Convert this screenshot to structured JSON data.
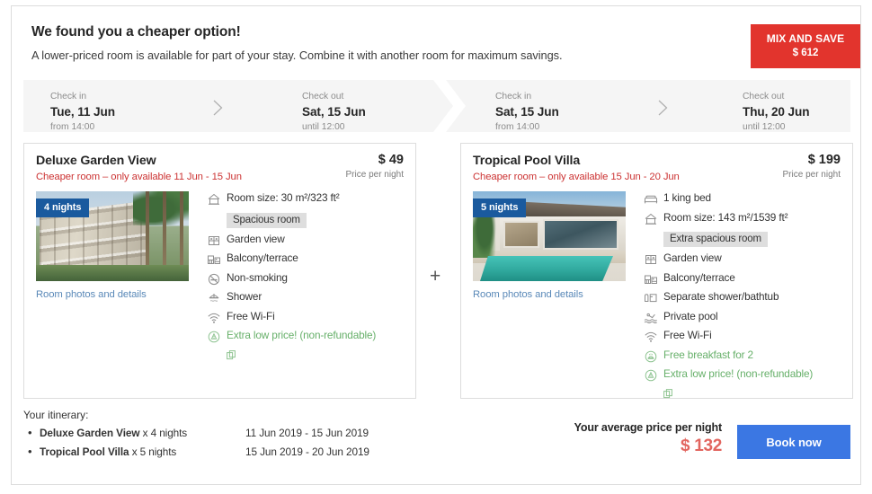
{
  "header": {
    "headline": "We found you a cheaper option!",
    "subline": "A lower-priced room is available for part of your stay. Combine it with another room for maximum savings.",
    "badge": {
      "title": "MIX AND SAVE",
      "amount": "$ 612",
      "color": "#e2342d"
    }
  },
  "timeline": [
    {
      "checkin_label": "Check in",
      "checkin_date": "Tue, 11 Jun",
      "checkin_time": "from 14:00",
      "checkout_label": "Check out",
      "checkout_date": "Sat, 15 Jun",
      "checkout_time": "until 12:00"
    },
    {
      "checkin_label": "Check in",
      "checkin_date": "Sat, 15 Jun",
      "checkin_time": "from 14:00",
      "checkout_label": "Check out",
      "checkout_date": "Thu, 20 Jun",
      "checkout_time": "until 12:00"
    }
  ],
  "separator": "+",
  "rooms": [
    {
      "name": "Deluxe Garden View",
      "note": "Cheaper room – only available 11 Jun - 15 Jun",
      "price": "$ 49",
      "price_label": "Price per night",
      "nights_badge": "4 nights",
      "photo_link": "Room photos and details",
      "amenities": [
        {
          "icon": "room-size-icon",
          "text": "Room size: 30 m²/323 ft²",
          "green": false
        },
        {
          "icon": "window-icon",
          "text": "Garden view",
          "green": false
        },
        {
          "icon": "balcony-icon",
          "text": "Balcony/terrace",
          "green": false
        },
        {
          "icon": "non-smoking-icon",
          "text": "Non-smoking",
          "green": false
        },
        {
          "icon": "shower-icon",
          "text": "Shower",
          "green": false
        },
        {
          "icon": "wifi-icon",
          "text": "Free Wi-Fi",
          "green": false
        },
        {
          "icon": "info-circle-icon",
          "text": "Extra low price! (non-refundable)",
          "green": true
        }
      ],
      "tag": "Spacious room",
      "tag_after_index": 0
    },
    {
      "name": "Tropical Pool Villa",
      "note": "Cheaper room – only available 15 Jun - 20 Jun",
      "price": "$ 199",
      "price_label": "Price per night",
      "nights_badge": "5 nights",
      "photo_link": "Room photos and details",
      "amenities": [
        {
          "icon": "bed-icon",
          "text": "1 king bed",
          "green": false
        },
        {
          "icon": "room-size-icon",
          "text": "Room size: 143 m²/1539 ft²",
          "green": false
        },
        {
          "icon": "window-icon",
          "text": "Garden view",
          "green": false
        },
        {
          "icon": "balcony-icon",
          "text": "Balcony/terrace",
          "green": false
        },
        {
          "icon": "bathtub-icon",
          "text": "Separate shower/bathtub",
          "green": false
        },
        {
          "icon": "pool-icon",
          "text": "Private pool",
          "green": false
        },
        {
          "icon": "wifi-icon",
          "text": "Free Wi-Fi",
          "green": false
        },
        {
          "icon": "breakfast-icon",
          "text": "Free breakfast for 2",
          "green": true
        },
        {
          "icon": "info-circle-icon",
          "text": "Extra low price! (non-refundable)",
          "green": true
        }
      ],
      "tag": "Extra spacious room",
      "tag_after_index": 1
    }
  ],
  "footer": {
    "itinerary_title": "Your itinerary:",
    "itinerary": [
      {
        "name": "Deluxe Garden View",
        "nights": "x 4 nights",
        "dates": "11 Jun 2019 - 15 Jun 2019"
      },
      {
        "name": "Tropical Pool Villa",
        "nights": "x 5 nights",
        "dates": "15 Jun 2019 - 20 Jun 2019"
      }
    ],
    "average_label": "Your average price per night",
    "average_price": "$ 132",
    "book_button": "Book now",
    "book_color": "#3b77e3",
    "price_color": "#e2655f"
  }
}
